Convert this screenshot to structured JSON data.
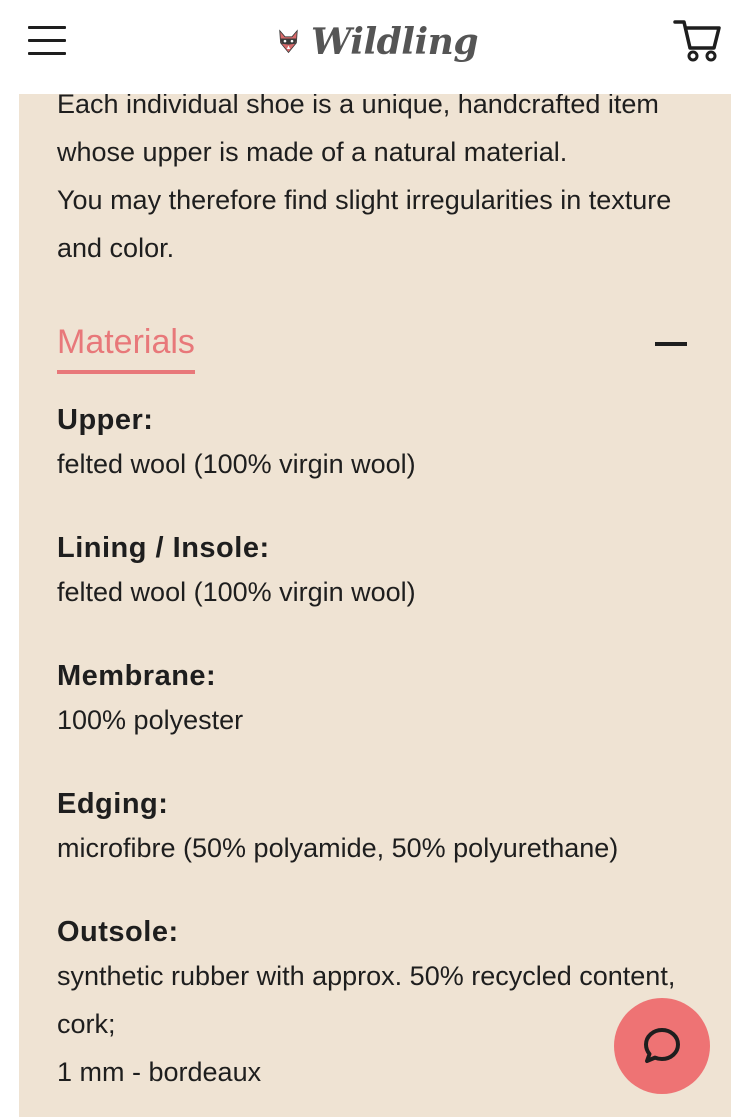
{
  "header": {
    "brand": "Wildling",
    "menu_icon": "hamburger-menu-icon",
    "cart_icon": "shopping-cart-icon",
    "logo_icon": "wolf-mask-logo-icon"
  },
  "intro": {
    "text": "Each individual shoe is a unique, handcrafted item whose upper is made of a natural material.",
    "text2": "You may therefore find slight irregularities in texture and color."
  },
  "materials": {
    "title": "Materials",
    "collapse_icon": "minus-icon",
    "items": [
      {
        "label": "Upper:",
        "value": [
          "felted wool (100% virgin wool)"
        ]
      },
      {
        "label": "Lining / Insole:",
        "value": [
          "felted wool (100% virgin wool)"
        ]
      },
      {
        "label": "Membrane:",
        "value": [
          "100% polyester"
        ]
      },
      {
        "label": "Edging:",
        "value": [
          "microfibre (50% polyamide, 50% polyurethane)"
        ]
      },
      {
        "label": "Outsole:",
        "value": [
          "synthetic rubber with approx. 50% recycled content, cork;",
          "1 mm - bordeaux"
        ]
      }
    ]
  },
  "chat": {
    "icon": "chat-bubble-icon"
  },
  "colors": {
    "accent": "#e8787a",
    "panel_background": "#efe3d3",
    "chat_button": "#ee7374",
    "text": "#1e1e1e"
  }
}
